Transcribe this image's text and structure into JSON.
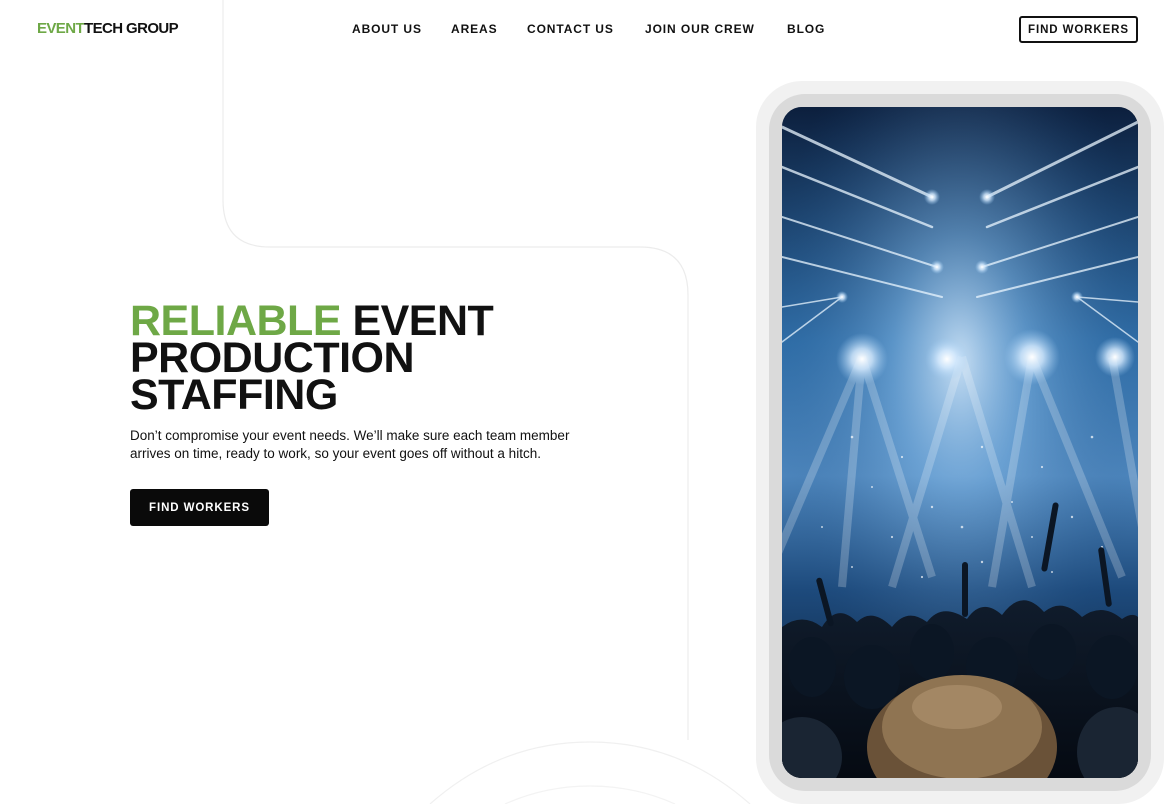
{
  "header": {
    "logo_part1": "EVENT",
    "logo_part2": "TECH GROUP",
    "nav": [
      "ABOUT US",
      "AREAS",
      "CONTACT US",
      "JOIN OUR CREW",
      "BLOG"
    ],
    "cta_label": "FIND WORKERS"
  },
  "hero": {
    "title_accent": "RELIABLE",
    "title_line1_rest": " EVENT",
    "title_line2": "PRODUCTION",
    "title_line3": "STAFFING",
    "description": "Don’t compromise your event needs. We’ll make sure each team member arrives on time, ready to work, so your event goes off without a hitch.",
    "cta_label": "FIND WORKERS"
  },
  "image": {
    "icon": "concert-crowd-photo"
  },
  "colors": {
    "accent": "#6ea846",
    "text": "#111111",
    "button": "#0a0a0a"
  }
}
